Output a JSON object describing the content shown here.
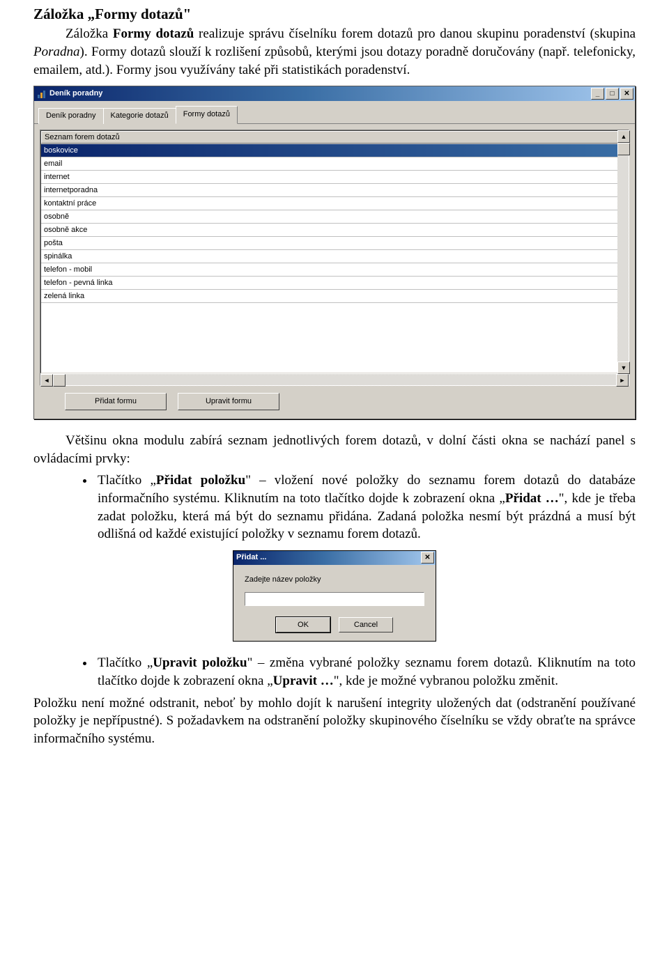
{
  "doc": {
    "heading": "Záložka „Formy dotazů\"",
    "p1_a": "Záložka ",
    "p1_b": "Formy dotazů",
    "p1_c": " realizuje správu číselníku forem dotazů pro danou skupinu poradenství (skupina ",
    "p1_d": "Poradna",
    "p1_e": "). Formy dotazů slouží k rozlišení způsobů, kterými jsou dotazy poradně doručovány (např. telefonicky, emailem, atd.). Formy jsou využívány také při statistikách poradenství.",
    "p2": "Většinu okna modulu zabírá seznam jednotlivých forem dotazů, v dolní části okna se nachází panel s ovládacími prvky:",
    "li1_a": "Tlačítko „",
    "li1_b": "Přidat položku",
    "li1_c": "\" – vložení nové položky do seznamu forem dotazů do databáze informačního systému. Kliknutím na toto tlačítko dojde k zobrazení okna „",
    "li1_d": "Přidat …",
    "li1_e": "\", kde je třeba zadat položku, která má být do seznamu přidána. Zadaná položka nesmí být prázdná a musí být odlišná od každé existující položky v seznamu forem dotazů.",
    "li2_a": "Tlačítko „",
    "li2_b": "Upravit položku",
    "li2_c": "\" – změna vybrané položky seznamu forem dotazů. Kliknutím na toto tlačítko dojde k zobrazení okna „",
    "li2_d": "Upravit …",
    "li2_e": "\", kde je možné vybranou položku změnit.",
    "p3": "Položku není možné odstranit, neboť by mohlo dojít k narušení integrity uložených dat (odstranění používané položky je nepřípustné). S požadavkem na odstranění položky skupinového číselníku se vždy obraťte na správce informačního systému."
  },
  "window": {
    "title": "Deník poradny",
    "tabs": [
      "Deník poradny",
      "Kategorie dotazů",
      "Formy dotazů"
    ],
    "activeTabIndex": 2,
    "gridHeader": "Seznam forem dotazů",
    "rows": [
      "boskovice",
      "email",
      "internet",
      "internetporadna",
      "kontaktní práce",
      "osobně",
      "osobně akce",
      "pošta",
      "spinálka",
      "telefon - mobil",
      "telefon - pevná linka",
      "zelená linka"
    ],
    "selectedRowIndex": 0,
    "buttons": {
      "add": "Přidat formu",
      "edit": "Upravit formu"
    }
  },
  "dialog": {
    "title": "Přidat ...",
    "label": "Zadejte název položky",
    "ok": "OK",
    "cancel": "Cancel",
    "inputValue": ""
  }
}
